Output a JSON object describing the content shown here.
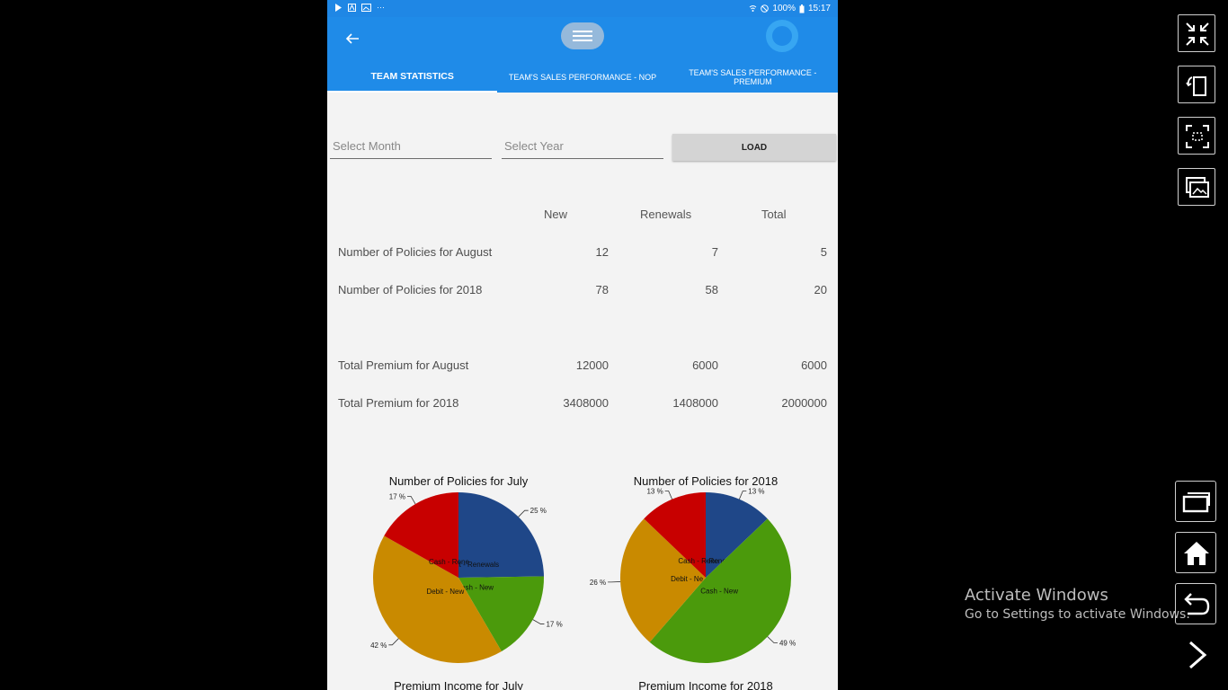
{
  "status_bar": {
    "battery": "100%",
    "time": "15:17"
  },
  "tabs": [
    {
      "label": "TEAM STATISTICS",
      "active": true
    },
    {
      "label": "TEAM'S SALES PERFORMANCE - NOP",
      "active": false
    },
    {
      "label": "TEAM'S SALES PERFORMANCE - PREMIUM",
      "active": false
    }
  ],
  "filters": {
    "month_placeholder": "Select Month",
    "year_placeholder": "Select Year",
    "load_label": "LOAD"
  },
  "table": {
    "columns": [
      "New",
      "Renewals",
      "Total"
    ],
    "rows": [
      {
        "label": "Number of Policies for August",
        "values": [
          "12",
          "7",
          "5"
        ]
      },
      {
        "label": "Number of Policies for 2018",
        "values": [
          "78",
          "58",
          "20"
        ]
      },
      {
        "label": "Total Premium for August",
        "values": [
          "12000",
          "6000",
          "6000"
        ]
      },
      {
        "label": "Total Premium for 2018",
        "values": [
          "3408000",
          "1408000",
          "2000000"
        ]
      }
    ]
  },
  "chart_data": [
    {
      "type": "pie",
      "title": "Number of Policies for July",
      "slices": [
        {
          "label": "Debit - Renewals",
          "value": 25,
          "color": "#1f4788"
        },
        {
          "label": "Cash - New",
          "value": 17,
          "color": "#4b9a0c"
        },
        {
          "label": "Debit - New",
          "value": 42,
          "color": "#c98a00"
        },
        {
          "label": "Cash - Rene",
          "value": 17,
          "color": "#c80000"
        }
      ],
      "value_labels": [
        "25 %",
        "17 %",
        "42 %",
        "17 %"
      ]
    },
    {
      "type": "pie",
      "title": "Number of Policies for 2018",
      "slices": [
        {
          "label": "Debit - Renewals",
          "value": 13,
          "color": "#1f4788"
        },
        {
          "label": "Cash - New",
          "value": 49,
          "color": "#4b9a0c"
        },
        {
          "label": "Debit - Ne",
          "value": 26,
          "color": "#c98a00"
        },
        {
          "label": "Cash - Rene",
          "value": 13,
          "color": "#c80000"
        }
      ],
      "value_labels": [
        "13 %",
        "49 %",
        "26 %",
        "13 %"
      ]
    }
  ],
  "chart_titles_below": [
    "Premium Income for July",
    "Premium Income for 2018"
  ],
  "windows": {
    "watermark_title": "Activate Windows",
    "watermark_sub": "Go to Settings to activate Windows."
  },
  "icons": {
    "back": "arrow-left-icon",
    "handle": "menu-handle-icon",
    "spinner": "loading-spinner-icon",
    "side": [
      "exit-fullscreen-icon",
      "rotate-icon",
      "screenshot-icon",
      "gallery-icon"
    ],
    "nav": [
      "recent-apps-icon",
      "home-icon",
      "back-icon",
      "next-icon"
    ]
  }
}
